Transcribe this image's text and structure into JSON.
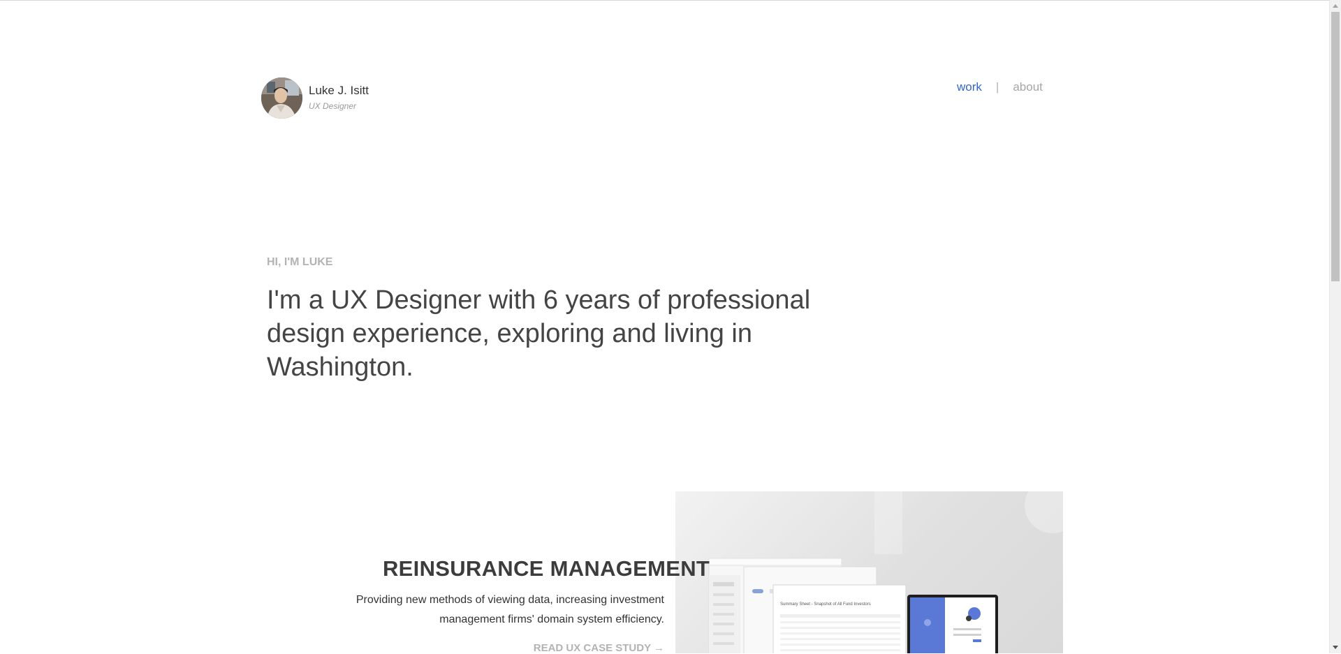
{
  "header": {
    "name": "Luke J. Isitt",
    "role": "UX Designer"
  },
  "nav": {
    "work": "work",
    "separator": "|",
    "about": "about",
    "active_color": "#3366cc"
  },
  "hero": {
    "eyebrow": "HI, I'M LUKE",
    "headline": "I'm a UX Designer with 6 years of professional design experience, exploring and living in Washington."
  },
  "project": {
    "title": "REINSURANCE MANAGEMENT",
    "description": "Providing new methods of viewing data, increasing investment management firms' domain system efficiency.",
    "cta": "READ UX CASE STUDY →",
    "mockup_heading": "Summary Sheet - Snapshot of All Fund Investors"
  },
  "icons": {
    "avatar": "profile-photo",
    "scroll_up": "triangle-up-icon",
    "scroll_down": "triangle-down-icon"
  }
}
